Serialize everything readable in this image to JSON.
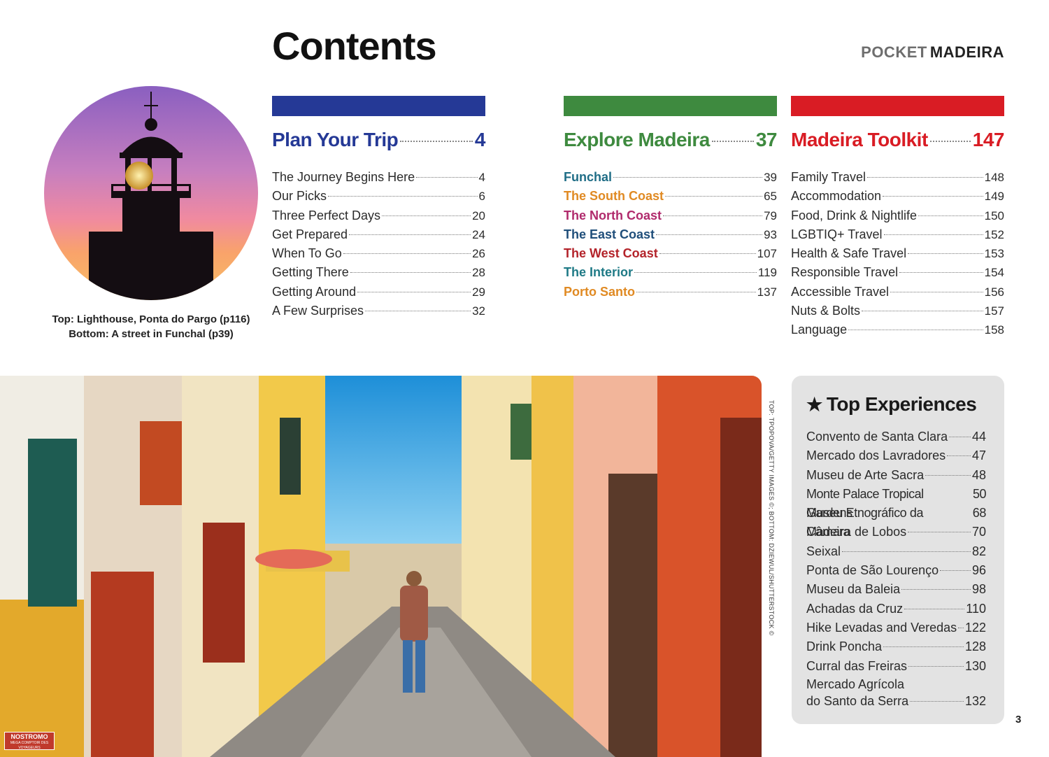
{
  "header": {
    "title": "Contents",
    "brand_pocket": "POCKET",
    "brand_place": "MADEIRA"
  },
  "caption": {
    "line1": "Top: Lighthouse, Ponta do Pargo (p116)",
    "line2": "Bottom: A street in Funchal (p39)"
  },
  "colors": {
    "plan": "#253996",
    "explore": "#3e8a3f",
    "toolkit": "#d91c24"
  },
  "plan": {
    "title": "Plan Your Trip",
    "page": "4",
    "items": [
      {
        "label": "The Journey Begins Here",
        "page": "4"
      },
      {
        "label": "Our Picks",
        "page": "6"
      },
      {
        "label": "Three Perfect Days",
        "page": "20"
      },
      {
        "label": "Get Prepared",
        "page": "24"
      },
      {
        "label": "When To Go",
        "page": "26"
      },
      {
        "label": "Getting There",
        "page": "28"
      },
      {
        "label": "Getting Around",
        "page": "29"
      },
      {
        "label": "A Few Surprises",
        "page": "32"
      }
    ]
  },
  "explore": {
    "title": "Explore Madeira",
    "page": "37",
    "items": [
      {
        "label": "Funchal",
        "page": "39",
        "color": "#1f6d86"
      },
      {
        "label": "The South Coast",
        "page": "65",
        "color": "#e08a23"
      },
      {
        "label": "The North Coast",
        "page": "79",
        "color": "#b02a6c"
      },
      {
        "label": "The East Coast",
        "page": "93",
        "color": "#1f4e7a"
      },
      {
        "label": "The West Coast",
        "page": "107",
        "color": "#b3232a"
      },
      {
        "label": "The Interior",
        "page": "119",
        "color": "#1f7a86"
      },
      {
        "label": "Porto Santo",
        "page": "137",
        "color": "#e08a23"
      }
    ]
  },
  "toolkit": {
    "title": "Madeira Toolkit",
    "page": "147",
    "items": [
      {
        "label": "Family Travel",
        "page": "148"
      },
      {
        "label": "Accommodation",
        "page": "149"
      },
      {
        "label": "Food, Drink & Nightlife",
        "page": "150"
      },
      {
        "label": "LGBTIQ+ Travel",
        "page": "152"
      },
      {
        "label": "Health & Safe Travel",
        "page": "153"
      },
      {
        "label": "Responsible Travel",
        "page": "154"
      },
      {
        "label": "Accessible Travel",
        "page": "156"
      },
      {
        "label": "Nuts & Bolts",
        "page": "157"
      },
      {
        "label": "Language",
        "page": "158"
      }
    ]
  },
  "top_experiences": {
    "title": "Top Experiences",
    "items": [
      {
        "label": "Convento de Santa Clara",
        "page": "44"
      },
      {
        "label": "Mercado dos Lavradores",
        "page": "47"
      },
      {
        "label": "Museu de Arte Sacra",
        "page": "48"
      },
      {
        "label": "Monte Palace Tropical Gardens",
        "page": "50"
      },
      {
        "label": "Museu Etnográfico da Madeira",
        "page": "68"
      },
      {
        "label": "Câmara de Lobos",
        "page": "70"
      },
      {
        "label": "Seixal",
        "page": "82"
      },
      {
        "label": "Ponta de São Lourenço",
        "page": "96"
      },
      {
        "label": "Museu da Baleia",
        "page": "98"
      },
      {
        "label": "Achadas da Cruz",
        "page": "110"
      },
      {
        "label": "Hike Levadas and Veredas",
        "page": "122"
      },
      {
        "label": "Drink Poncha",
        "page": "128"
      },
      {
        "label": "Curral das Freiras",
        "page": "130"
      }
    ],
    "last": {
      "line1": "Mercado Agrícola",
      "line2": "do Santo da Serra",
      "page": "132"
    }
  },
  "photo_credit": "TOP: TPOPOVA/GETTY IMAGES ©; BOTTOM: DZIEWUL/SHUTTERSTOCK ©",
  "page_number": "3",
  "logo": {
    "name": "NOSTROMO",
    "tagline": "MEGA COMPTOIR DES VOYAGEURS"
  }
}
